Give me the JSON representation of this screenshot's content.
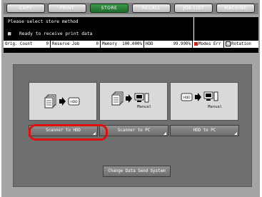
{
  "tabs": [
    {
      "label": "COPY",
      "active": false
    },
    {
      "label": "PRINT",
      "active": false
    },
    {
      "label": "STORE",
      "active": true
    },
    {
      "label": "RECALL",
      "active": false
    },
    {
      "label": "JOB LIST",
      "active": false
    },
    {
      "label": "MACHINE",
      "active": false
    }
  ],
  "status": {
    "title": "Please select store method",
    "message": "Ready to receive print data",
    "info": {
      "orig_count_label": "Orig. Count",
      "orig_count_value": "0",
      "reserve_label": "Reserve Job",
      "reserve_value": "0",
      "memory_label": "Memory",
      "memory_value": "100.000%",
      "hdd_label": "HDD",
      "hdd_value": "99.990%",
      "modes_label": "Modes Err",
      "rotation_label": "Rotation"
    }
  },
  "options": [
    {
      "label": "Scanner to HDD",
      "caption": "",
      "icon": "scanner-to-hdd-icon",
      "selected": true
    },
    {
      "label": "Scanner to PC",
      "caption": "Manual",
      "icon": "scanner-to-pc-icon",
      "selected": false
    },
    {
      "label": "HDD to PC",
      "caption": "Manual",
      "icon": "hdd-to-pc-icon",
      "selected": false
    }
  ],
  "icon_text": {
    "hdd": "HDD"
  },
  "change_button": "Change Data Send System",
  "colors": {
    "active_tab": "#2a8a3a",
    "highlight": "#e01010",
    "panel": "#6f6f6f"
  }
}
